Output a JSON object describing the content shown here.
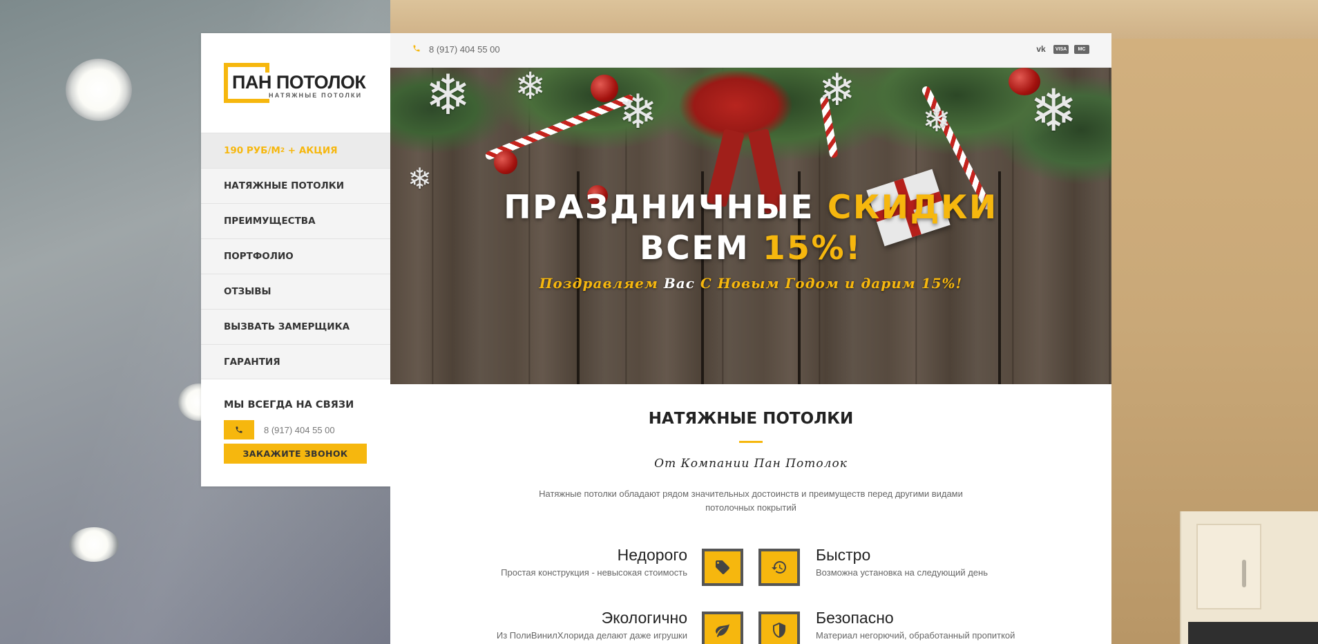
{
  "brand": {
    "title": "ПАН ПОТОЛОК",
    "subtitle": "НАТЯЖНЫЕ ПОТОЛКИ",
    "accent_color": "#f6b70e"
  },
  "nav": {
    "items": [
      {
        "label": "190 РУБ/М",
        "sup": "2",
        "suffix": " + АКЦИЯ",
        "active": true
      },
      {
        "label": "НАТЯЖНЫЕ ПОТОЛКИ"
      },
      {
        "label": "ПРЕИМУЩЕСТВА"
      },
      {
        "label": "ПОРТФОЛИО"
      },
      {
        "label": "ОТЗЫВЫ"
      },
      {
        "label": "ВЫЗВАТЬ ЗАМЕРЩИКА"
      },
      {
        "label": "ГАРАНТИЯ"
      }
    ]
  },
  "contact": {
    "title": "МЫ ВСЕГДА НА СВЯЗИ",
    "phone": "8 (917) 404 55 00",
    "callback_label": "ЗАКАЖИТЕ ЗВОНОК"
  },
  "topbar": {
    "phone": "8 (917) 404 55 00",
    "social": [
      "vk-icon",
      "visa-icon",
      "mastercard-icon"
    ],
    "vk_label": "vk",
    "visa_label": "VISA",
    "mc_label": "MC"
  },
  "hero": {
    "line1_white": "ПРАЗДНИЧНЫЕ",
    "line1_accent": "СКИДКИ",
    "line2_white": "ВСЕМ",
    "line2_accent": "15%!",
    "sub_a": "Поздравляем ",
    "sub_b": "Вас",
    "sub_c": " С Новым Годом и дарим 15%!"
  },
  "section": {
    "title": "НАТЯЖНЫЕ ПОТОЛКИ",
    "script": "От Компании Пан Потолок",
    "text": "Натяжные потолки обладают рядом значительных достоинств и преимуществ перед другими видами потолочных покрытий"
  },
  "features": [
    {
      "title": "Недорого",
      "desc": "Простая конструкция - невысокая стоимость",
      "icon": "tag-icon"
    },
    {
      "title": "Быстро",
      "desc": "Возможна установка на следующий день",
      "icon": "history-icon"
    },
    {
      "title": "Экологично",
      "desc": "Из ПолиВинилХлорида делают даже игрушки",
      "icon": "leaf-icon"
    },
    {
      "title": "Безопасно",
      "desc": "Материал негорючий, обработанный пропиткой",
      "icon": "shield-icon"
    }
  ]
}
